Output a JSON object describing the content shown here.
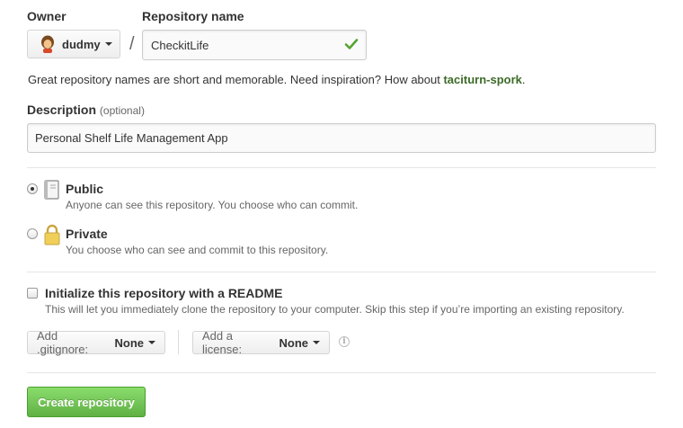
{
  "owner": {
    "label": "Owner",
    "value": "dudmy"
  },
  "separator": "/",
  "repo": {
    "label": "Repository name",
    "value": "CheckitLife"
  },
  "hint": {
    "text": "Great repository names are short and memorable. Need inspiration? How about ",
    "suggestion": "taciturn-spork",
    "end": "."
  },
  "description": {
    "label": "Description",
    "optional": "(optional)",
    "value": "Personal Shelf Life Management App"
  },
  "visibility": {
    "public": {
      "title": "Public",
      "desc": "Anyone can see this repository. You choose who can commit.",
      "selected": true
    },
    "private": {
      "title": "Private",
      "desc": "You choose who can see and commit to this repository.",
      "selected": false
    }
  },
  "readme": {
    "title": "Initialize this repository with a README",
    "desc": "This will let you immediately clone the repository to your computer. Skip this step if you’re importing an existing repository.",
    "checked": false
  },
  "gitignore": {
    "label": "Add .gitignore:",
    "value": "None"
  },
  "license": {
    "label": "Add a license:",
    "value": "None"
  },
  "info_icon": "info-icon",
  "create_button": "Create repository",
  "colors": {
    "accent_green": "#60b044",
    "suggestion": "#3c6b27",
    "check": "#55a532"
  }
}
